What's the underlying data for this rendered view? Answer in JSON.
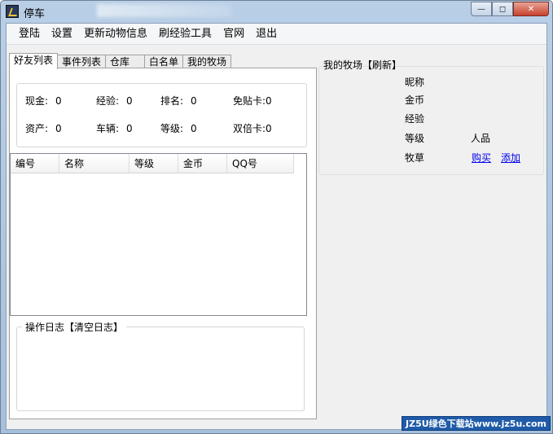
{
  "window": {
    "title": "停车"
  },
  "menu": [
    "登陆",
    "设置",
    "更新动物信息",
    "刷经验工具",
    "官网",
    "退出"
  ],
  "tabs": [
    "好友列表",
    "事件列表",
    "仓库",
    "白名单",
    "我的牧场"
  ],
  "stats": {
    "cash_label": "现金:",
    "cash": "0",
    "exp_label": "经验:",
    "exp": "0",
    "rank_label": "排名:",
    "rank": "0",
    "free_card_label": "免贴卡:",
    "free_card": "0",
    "assets_label": "资产:",
    "assets": "0",
    "vehicles_label": "车辆:",
    "vehicles": "0",
    "level_label": "等级:",
    "level": "0",
    "double_card_label": "双倍卡:",
    "double_card": "0"
  },
  "grid": {
    "columns": [
      "编号",
      "名称",
      "等级",
      "金币",
      "QQ号"
    ]
  },
  "log": {
    "legend": "操作日志【清空日志】"
  },
  "ranch": {
    "title": "我的牧场【刷新】",
    "nickname_label": "昵称",
    "gold_label": "金币",
    "exp_label": "经验",
    "level_label": "等级",
    "karma_label": "人品",
    "grass_label": "牧草",
    "buy_link": "购买",
    "add_link": "添加"
  },
  "watermark": "JZ5U绿色下载站www.jz5u.com"
}
